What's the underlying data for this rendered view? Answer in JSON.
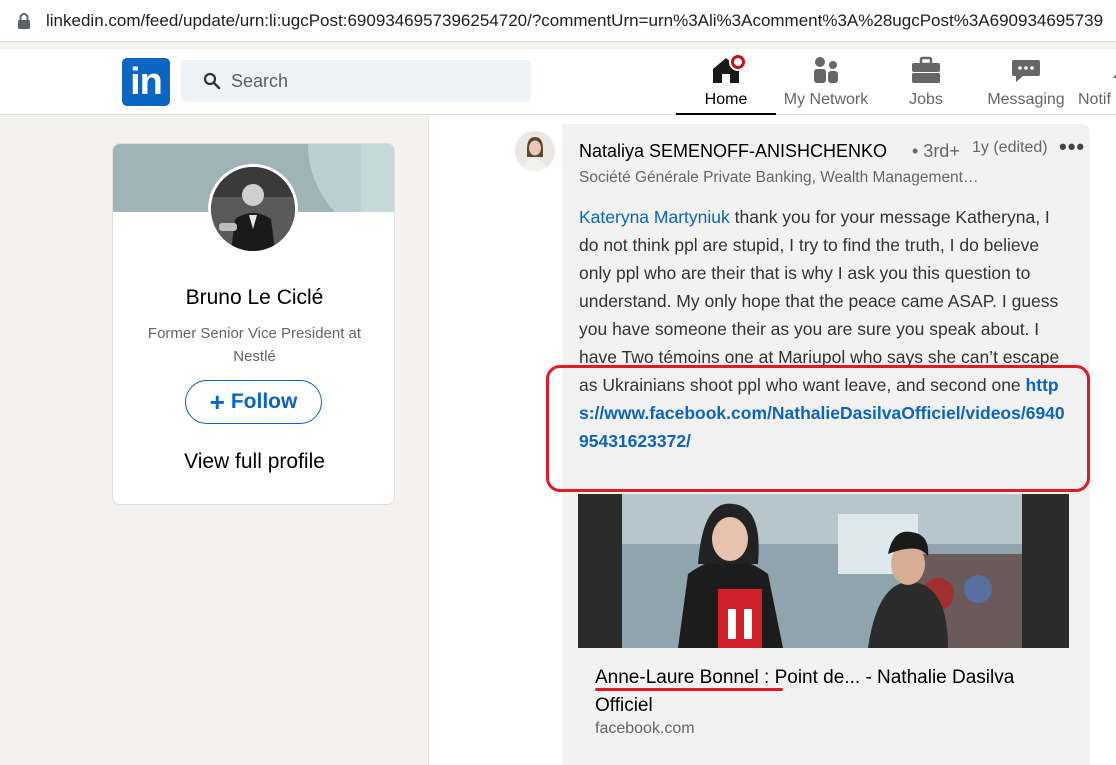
{
  "browser": {
    "url": "linkedin.com/feed/update/urn:li:ugcPost:6909346957396254720/?commentUrn=urn%3Ali%3Acomment%3A%28ugcPost%3A690934695739"
  },
  "nav": {
    "logo": "in",
    "search_placeholder": "Search",
    "items": [
      {
        "label": "Home",
        "icon": "home-icon",
        "active": true
      },
      {
        "label": "My Network",
        "icon": "network-icon"
      },
      {
        "label": "Jobs",
        "icon": "briefcase-icon"
      },
      {
        "label": "Messaging",
        "icon": "chat-icon"
      },
      {
        "label": "Notif",
        "icon": "bell-icon"
      }
    ]
  },
  "profile": {
    "name": "Bruno Le Ciclé",
    "title": "Former Senior Vice President at Nestlé",
    "follow_label": "Follow",
    "view_profile_label": "View full profile"
  },
  "comment": {
    "author": "Nataliya SEMENOFF-ANISHCHENKO",
    "degree": "• 3rd+",
    "meta": "1y (edited)",
    "headline": "Société Générale Private Banking, Wealth Management…",
    "mention": "Kateryna Martyniuk",
    "text_part1": " thank you for your message Katheryna, I do not think ppl are stupid, I try to find the truth, I do believe only ppl who are their that is why I ask you this question to understand. My only hope that the peace came ASAP. I guess you have someone their as you are sure you speak about. I have Two témoins one at Mariupol who says she can’t escape as Ukrainians shoot ppl who want leave, and second one ",
    "link": "https://www.facebook.com/NathalieDasilvaOfficiel/videos/694095431623372/",
    "link_card": {
      "title_underlined": "Anne-Laure Bonnel :",
      "title_rest": " Point de... - Nathalie Dasilva Officiel",
      "domain": "facebook.com"
    }
  },
  "colors": {
    "linkedin_blue": "#0a66c2",
    "highlight_red": "#e01b24",
    "notification_red": "#cc1016"
  }
}
